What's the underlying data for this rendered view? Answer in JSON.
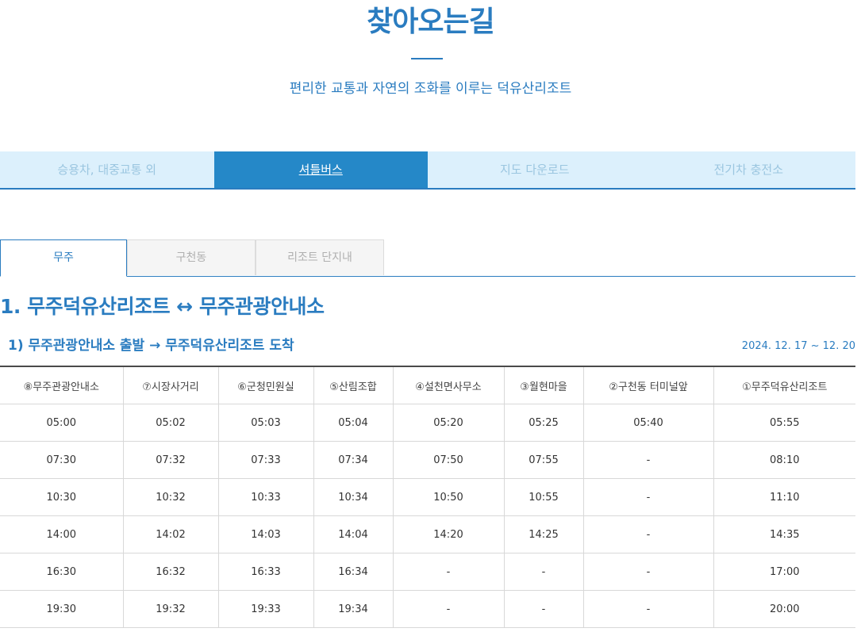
{
  "header": {
    "title": "찾아오는길",
    "subtitle": "편리한 교통과 자연의 조화를 이루는 덕유산리조트"
  },
  "main_tabs": [
    {
      "label": "승용차, 대중교통 외"
    },
    {
      "label": "셔틀버스"
    },
    {
      "label": "지도 다운로드"
    },
    {
      "label": "전기차 충전소"
    }
  ],
  "sub_tabs": [
    {
      "label": "무주"
    },
    {
      "label": "구천동"
    },
    {
      "label": "리조트 단지내"
    }
  ],
  "section": {
    "heading": "1. 무주덕유산리조트 ↔ 무주관광안내소",
    "route_heading": "1) 무주관광안내소 출발 → 무주덕유산리조트 도착",
    "period": "2024. 12. 17 ~ 12. 20"
  },
  "table": {
    "headers": [
      "⑧무주관광안내소",
      "⑦시장사거리",
      "⑥군청민원실",
      "⑤산림조합",
      "④설천면사무소",
      "③월현마을",
      "②구천동 터미널앞",
      "①무주덕유산리조트"
    ],
    "rows": [
      [
        "05:00",
        "05:02",
        "05:03",
        "05:04",
        "05:20",
        "05:25",
        "05:40",
        "05:55"
      ],
      [
        "07:30",
        "07:32",
        "07:33",
        "07:34",
        "07:50",
        "07:55",
        "-",
        "08:10"
      ],
      [
        "10:30",
        "10:32",
        "10:33",
        "10:34",
        "10:50",
        "10:55",
        "-",
        "11:10"
      ],
      [
        "14:00",
        "14:02",
        "14:03",
        "14:04",
        "14:20",
        "14:25",
        "-",
        "14:35"
      ],
      [
        "16:30",
        "16:32",
        "16:33",
        "16:34",
        "-",
        "-",
        "-",
        "17:00"
      ],
      [
        "19:30",
        "19:32",
        "19:33",
        "19:34",
        "-",
        "-",
        "-",
        "20:00"
      ]
    ]
  }
}
